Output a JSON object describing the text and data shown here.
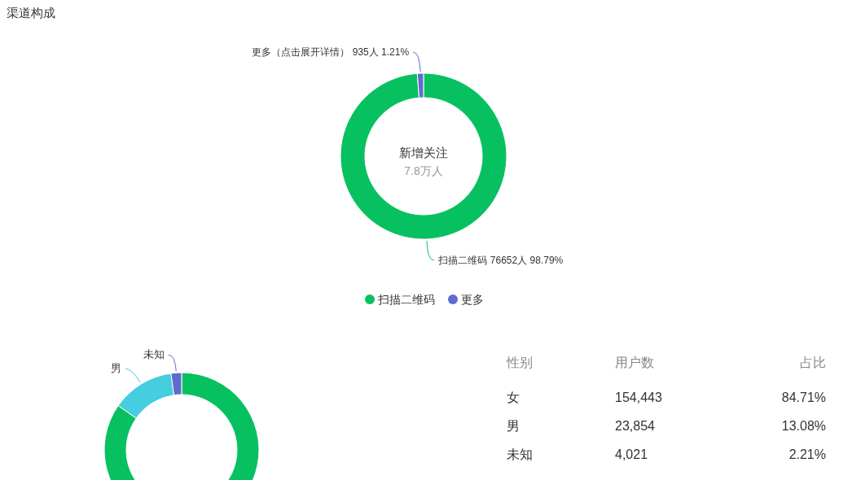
{
  "title": "渠道构成",
  "channel_chart": {
    "center_title": "新增关注",
    "center_value": "7.8万人",
    "chart_data": {
      "type": "donut",
      "categories": [
        "扫描二维码",
        "更多（点击展开详情）"
      ],
      "values": [
        76652,
        935
      ],
      "colors": [
        "#07c160",
        "#5f6ccf"
      ],
      "value_labels": [
        "76652人 98.79%",
        "935人 1.21%"
      ]
    }
  },
  "legend": [
    {
      "label": "扫描二维码",
      "color": "#07c160"
    },
    {
      "label": "更多",
      "color": "#5f6ccf"
    }
  ],
  "gender_chart": {
    "chart_data": {
      "type": "donut",
      "values": [
        84.71,
        13.08,
        2.21
      ],
      "value_labels": [
        null,
        "男",
        "未知"
      ],
      "colors": [
        "#07c160",
        "#45cde0",
        "#5f6ccf"
      ]
    }
  },
  "gender_table": {
    "columns": [
      "性别",
      "用户数",
      "占比"
    ],
    "rows": [
      [
        "女",
        "154,443",
        "84.71%"
      ],
      [
        "男",
        "23,854",
        "13.08%"
      ],
      [
        "未知",
        "4,021",
        "2.21%"
      ]
    ]
  }
}
